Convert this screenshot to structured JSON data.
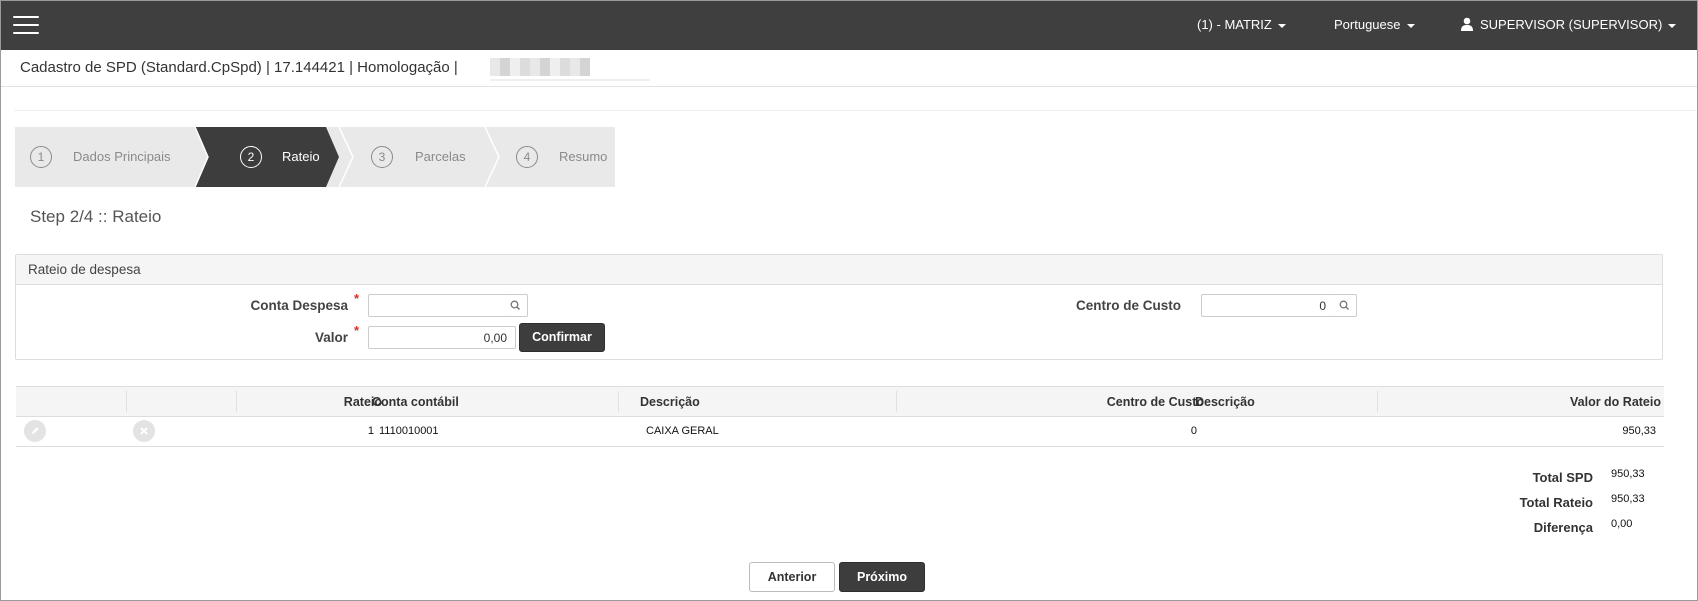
{
  "topbar": {
    "branch": "(1) - MATRIZ",
    "language": "Portuguese",
    "user": "SUPERVISOR (SUPERVISOR)"
  },
  "page_title": "Cadastro de SPD (Standard.CpSpd) | 17.144421 | Homologação |",
  "wizard": {
    "steps": [
      {
        "num": "1",
        "label": "Dados Principais"
      },
      {
        "num": "2",
        "label": "Rateio"
      },
      {
        "num": "3",
        "label": "Parcelas"
      },
      {
        "num": "4",
        "label": "Resumo"
      }
    ],
    "active_index": 1,
    "heading": "Step 2/4 :: Rateio"
  },
  "panel": {
    "title": "Rateio de despesa",
    "conta_despesa_label": "Conta Despesa",
    "conta_despesa_value": "",
    "valor_label": "Valor",
    "valor_value": "0,00",
    "centro_custo_label": "Centro de Custo",
    "centro_custo_value": "0",
    "required_mark": "*",
    "confirm_label": "Confirmar"
  },
  "table": {
    "headers": {
      "rateio": "Rateio",
      "conta": "Conta contábil",
      "descricao": "Descrição",
      "centro": "Centro de Custo",
      "descricao2": "Descrição",
      "valor": "Valor do Rateio"
    },
    "rows": [
      {
        "rateio": "1",
        "conta": "1110010001",
        "descricao": "CAIXA GERAL",
        "centro": "0",
        "descricao2": "",
        "valor": "950,33"
      }
    ]
  },
  "totals": {
    "total_spd_label": "Total SPD",
    "total_spd_value": "950,33",
    "total_rateio_label": "Total Rateio",
    "total_rateio_value": "950,33",
    "diferenca_label": "Diferença",
    "diferenca_value": "0,00"
  },
  "nav": {
    "prev_label": "Anterior",
    "next_label": "Próximo"
  },
  "colors": {
    "topbar": "#3f3f3f",
    "active_step": "#3d3d3d",
    "wizard_bg": "#e9e9e9",
    "required": "#d9302c"
  },
  "icons": [
    "menu-icon",
    "caret-down-icon",
    "user-icon",
    "search-icon",
    "edit-icon",
    "delete-icon"
  ]
}
